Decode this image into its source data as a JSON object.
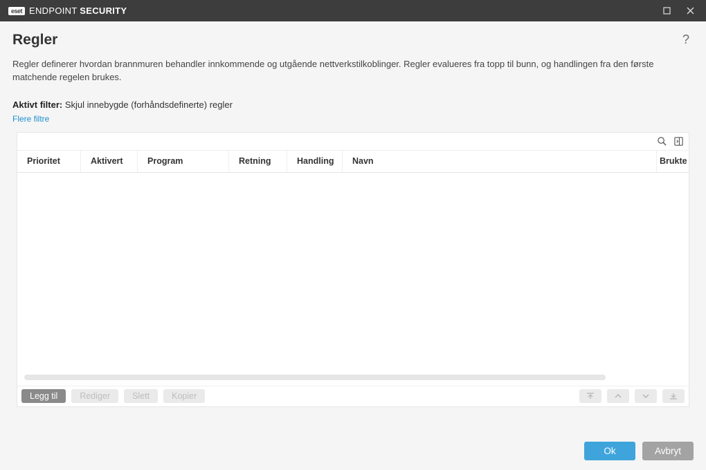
{
  "titlebar": {
    "brand_badge": "eset",
    "brand_light": "ENDPOINT ",
    "brand_bold": "SECURITY"
  },
  "page": {
    "title": "Regler",
    "description": "Regler definerer hvordan brannmuren behandler innkommende og utgående nettverkstilkoblinger. Regler evalueres fra topp til bunn, og handlingen fra den første matchende regelen brukes."
  },
  "filter": {
    "label": "Aktivt filter:",
    "value": "Skjul innebygde (forhåndsdefinerte) regler",
    "more": "Flere filtre"
  },
  "columns": {
    "priority": "Prioritet",
    "activated": "Aktivert",
    "program": "Program",
    "direction": "Retning",
    "action": "Handling",
    "name": "Navn",
    "used": "Brukte"
  },
  "buttons": {
    "add": "Legg til",
    "edit": "Rediger",
    "delete": "Slett",
    "copy": "Kopier",
    "ok": "Ok",
    "cancel": "Avbryt"
  }
}
